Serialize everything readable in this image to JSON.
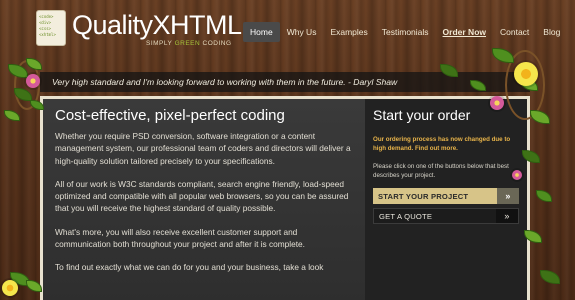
{
  "header": {
    "logo_icon_lines": [
      "<code>",
      "<div>",
      "<css>",
      "<xhtml>"
    ],
    "logo_name_a": "Quality",
    "logo_name_b": "XHTML",
    "tagline_a": "SIMPLY ",
    "tagline_b": "GREEN",
    "tagline_c": " CODING"
  },
  "nav": [
    {
      "label": "Home"
    },
    {
      "label": "Why Us"
    },
    {
      "label": "Examples"
    },
    {
      "label": "Testimonials"
    },
    {
      "label": "Order Now"
    },
    {
      "label": "Contact"
    },
    {
      "label": "Blog"
    }
  ],
  "quote": {
    "text": "Very high standard and I'm looking forward to working with them in the future.",
    "author": " - Daryl Shaw"
  },
  "main": {
    "heading": "Cost-effective, pixel-perfect coding",
    "paragraphs": [
      "Whether you require PSD conversion, software integration or a content management system, our professional team of coders and directors will deliver a high-quality solution tailored precisely to your specifications.",
      "All of our work is W3C standards compliant, search engine friendly, load-speed optimized and compatible with all popular web browsers, so you can be assured that you will receive the highest standard of quality possible.",
      "What's more, you will also receive excellent customer support and communication both throughout your project and after it is complete.",
      "To find out exactly what we can do for you and your business, take a look"
    ]
  },
  "order": {
    "heading": "Start your order",
    "notice": "Our ordering process has now changed due to high demand. Find out more.",
    "instruction": "Please click on one of the buttons below that best describes your project.",
    "start_button": "START YOUR PROJECT",
    "quote_button": "GET A QUOTE",
    "arrow": "»"
  },
  "colors": {
    "wood": "#5a341c",
    "panel": "#2e2e2e",
    "accent_gold": "#d7c488",
    "notice_orange": "#e8b44a",
    "leaf_green": "#4f8f1f"
  }
}
